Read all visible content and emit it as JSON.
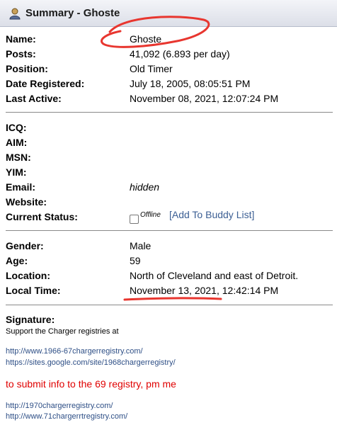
{
  "header": {
    "title": "Summary - Ghoste",
    "icon": "user-icon"
  },
  "profile": {
    "name": {
      "label": "Name:",
      "value": "Ghoste"
    },
    "posts": {
      "label": "Posts:",
      "value": "41,092 (6.893 per day)"
    },
    "position": {
      "label": "Position:",
      "value": "Old Timer"
    },
    "date_registered": {
      "label": "Date Registered:",
      "value": "July 18, 2005, 08:05:51 PM"
    },
    "last_active": {
      "label": "Last Active:",
      "value": "November 08, 2021, 12:07:24 PM"
    }
  },
  "contact": {
    "icq": {
      "label": "ICQ:"
    },
    "aim": {
      "label": "AIM:"
    },
    "msn": {
      "label": "MSN:"
    },
    "yim": {
      "label": "YIM:"
    },
    "email": {
      "label": "Email:",
      "value": "hidden"
    },
    "website": {
      "label": "Website:"
    },
    "current_status": {
      "label": "Current Status:",
      "status": "Offline",
      "buddy_link": "[Add To Buddy List]"
    }
  },
  "personal": {
    "gender": {
      "label": "Gender:",
      "value": "Male"
    },
    "age": {
      "label": "Age:",
      "value": "59"
    },
    "location": {
      "label": "Location:",
      "value": "North of Cleveland and east of Detroit."
    },
    "local_time": {
      "label": "Local Time:",
      "value": "November 13, 2021, 12:42:14 PM"
    }
  },
  "signature": {
    "label": "Signature:",
    "line1": "Support the Charger registries at",
    "link1": "http://www.1966-67chargerregistry.com/",
    "link2": "https://sites.google.com/site/1968chargerregistry/",
    "red_text": "to submit info to the 69 registry, pm me",
    "link3": "http://1970chargerregistry.com/",
    "link4": "http://www.71chargerrtregistry.com/"
  },
  "colors": {
    "annotation": "#e8362f",
    "link": "#2e4f86",
    "red_text": "#e00000"
  }
}
